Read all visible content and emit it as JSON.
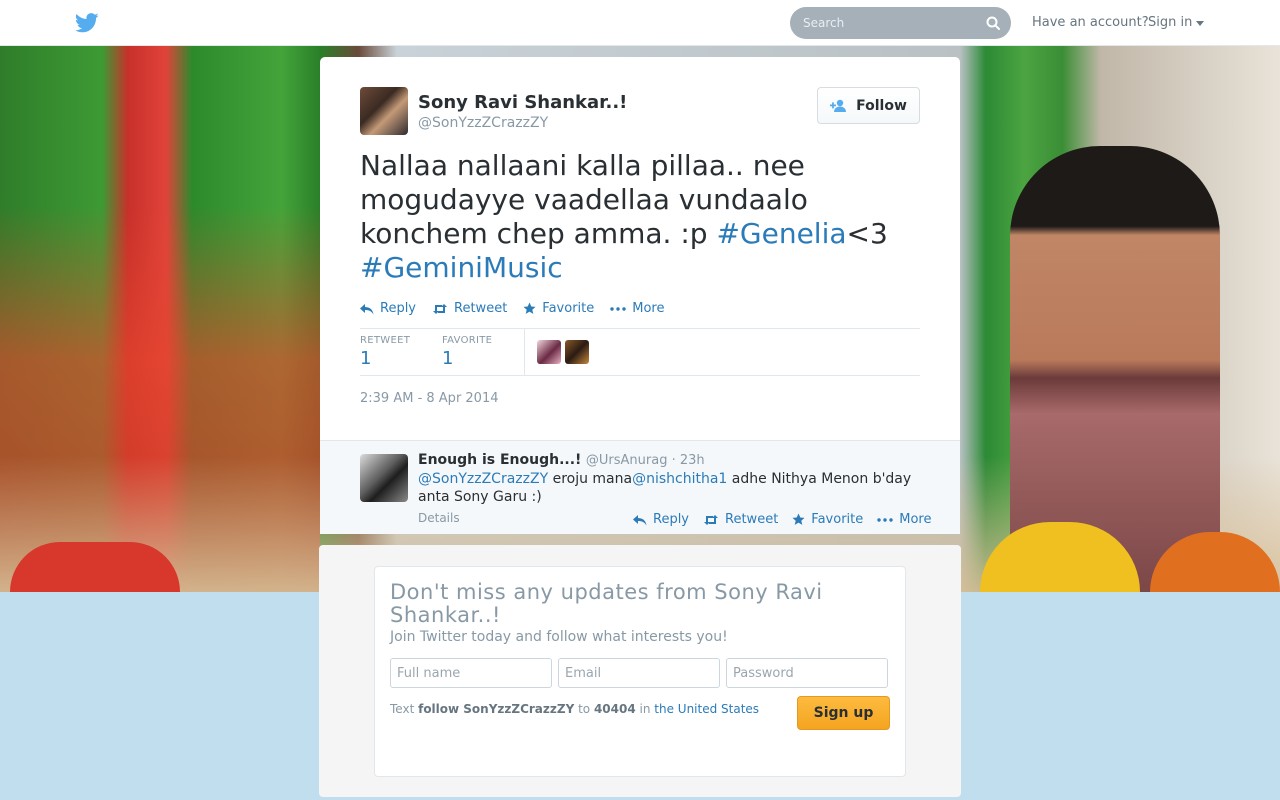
{
  "topbar": {
    "search_placeholder": "Search",
    "have_account": "Have an account?",
    "sign_in": "Sign in"
  },
  "tweet": {
    "author": {
      "fullname": "Sony Ravi Shankar..!",
      "screenname": "@SonYzzZCrazzZY"
    },
    "follow_label": "Follow",
    "text_plain": "Nallaa nallaani kalla pillaa.. nee mogudayye vaadellaa vundaalo konchem chep amma. :p ",
    "hashtag_1": "#Genelia",
    "text_mid": "<3",
    "hashtag_2": "#GeminiMusic",
    "actions": {
      "reply": "Reply",
      "retweet": "Retweet",
      "favorite": "Favorite",
      "more": "More"
    },
    "stats": {
      "retweet_label": "RETWEET",
      "retweet_count": "1",
      "favorite_label": "FAVORITE",
      "favorite_count": "1"
    },
    "timestamp": "2:39 AM - 8 Apr 2014"
  },
  "reply": {
    "fullname": "Enough is Enough...!",
    "screenname": "@UrsAnurag",
    "separator": " · ",
    "time": "23h",
    "mention_1": "@SonYzzZCrazzZY",
    "text_1": " eroju mana",
    "mention_2": "@nishchitha1",
    "text_2": " adhe Nithya Menon b'day anta Sony Garu :)",
    "details": "Details",
    "actions": {
      "reply": "Reply",
      "retweet": "Retweet",
      "favorite": "Favorite",
      "more": "More"
    }
  },
  "signup": {
    "title": "Don't miss any updates from Sony Ravi Shankar..!",
    "subtitle": "Join Twitter today and follow what interests you!",
    "fullname_placeholder": "Full name",
    "email_placeholder": "Email",
    "password_placeholder": "Password",
    "text_prefix": "Text ",
    "text_command": "follow SonYzzZCrazzZY",
    "text_to": " to ",
    "text_number": "40404",
    "text_in": " in ",
    "text_country": "the United States",
    "button": "Sign up"
  },
  "colors": {
    "link": "#2b7bb9",
    "bird": "#55acee",
    "signup_button": "#f4a420",
    "background": "#c0deed"
  }
}
